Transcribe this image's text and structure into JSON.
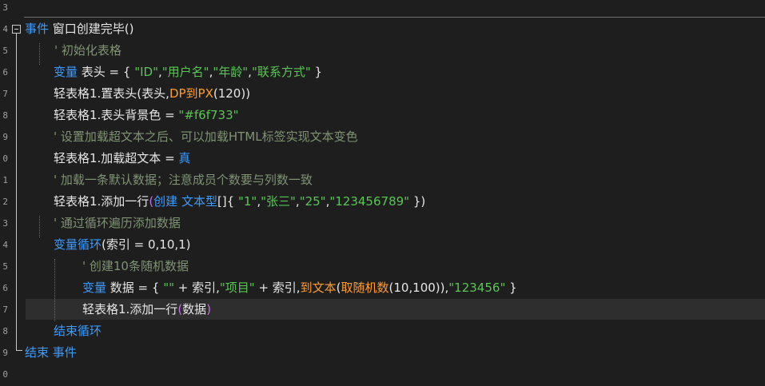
{
  "editor": {
    "line_numbers": [
      "3",
      "4",
      "5",
      "6",
      "7",
      "8",
      "9",
      "0",
      "1",
      "2",
      "3",
      "4",
      "5",
      "6",
      "7",
      "8",
      "9",
      "0"
    ],
    "lines": [
      {
        "tokens": [
          {
            "t": "事件",
            "c": "kw"
          },
          {
            "t": " 窗口创建完毕()",
            "c": "id"
          }
        ]
      },
      {
        "tokens": [
          {
            "t": "' 初始化表格",
            "c": "cm"
          }
        ]
      },
      {
        "tokens": [
          {
            "t": "变量",
            "c": "kw"
          },
          {
            "t": " 表头 = { ",
            "c": "id"
          },
          {
            "t": "\"ID\"",
            "c": "str"
          },
          {
            "t": ",",
            "c": "id"
          },
          {
            "t": "\"用户名\"",
            "c": "str"
          },
          {
            "t": ",",
            "c": "id"
          },
          {
            "t": "\"年龄\"",
            "c": "str"
          },
          {
            "t": ",",
            "c": "id"
          },
          {
            "t": "\"联系方式\"",
            "c": "str"
          },
          {
            "t": " }",
            "c": "id"
          }
        ]
      },
      {
        "tokens": [
          {
            "t": "轻表格1.置表头(表头,",
            "c": "id"
          },
          {
            "t": "DP到PX",
            "c": "fn"
          },
          {
            "t": "(120))",
            "c": "id"
          }
        ]
      },
      {
        "tokens": [
          {
            "t": "轻表格1.表头背景色 = ",
            "c": "id"
          },
          {
            "t": "\"#f6f733\"",
            "c": "str"
          }
        ]
      },
      {
        "tokens": [
          {
            "t": "' 设置加载超文本之后、可以加载HTML标签实现文本变色",
            "c": "cm"
          }
        ]
      },
      {
        "tokens": [
          {
            "t": "轻表格1.加载超文本 = ",
            "c": "id"
          },
          {
            "t": "真",
            "c": "kw"
          }
        ]
      },
      {
        "tokens": [
          {
            "t": "' 加载一条默认数据；注意成员个数要与列数一致",
            "c": "cm"
          }
        ]
      },
      {
        "tokens": [
          {
            "t": "轻表格1.添加一行",
            "c": "id"
          },
          {
            "t": "(",
            "c": "par-p"
          },
          {
            "t": "创建 文本型",
            "c": "kw"
          },
          {
            "t": "[]{ ",
            "c": "id"
          },
          {
            "t": "\"1\"",
            "c": "str"
          },
          {
            "t": ",",
            "c": "id"
          },
          {
            "t": "\"张三\"",
            "c": "str"
          },
          {
            "t": ",",
            "c": "id"
          },
          {
            "t": "\"25\"",
            "c": "str"
          },
          {
            "t": ",",
            "c": "id"
          },
          {
            "t": "\"123456789\"",
            "c": "str"
          },
          {
            "t": " })",
            "c": "id"
          }
        ]
      },
      {
        "tokens": [
          {
            "t": "' 通过循环遍历添加数据",
            "c": "cm"
          }
        ]
      },
      {
        "tokens": [
          {
            "t": "变量循环",
            "c": "kw"
          },
          {
            "t": "(索引 = 0,10,1)",
            "c": "id"
          }
        ]
      },
      {
        "tokens": [
          {
            "t": "' 创建10条随机数据",
            "c": "cm"
          }
        ]
      },
      {
        "tokens": [
          {
            "t": "变量",
            "c": "kw"
          },
          {
            "t": " 数据 = { ",
            "c": "id"
          },
          {
            "t": "\"\"",
            "c": "str"
          },
          {
            "t": " + 索引,",
            "c": "id"
          },
          {
            "t": "\"项目\"",
            "c": "str"
          },
          {
            "t": " + 索引,",
            "c": "id"
          },
          {
            "t": "到文本",
            "c": "fn"
          },
          {
            "t": "(",
            "c": "id"
          },
          {
            "t": "取随机数",
            "c": "fn"
          },
          {
            "t": "(10,100)),",
            "c": "id"
          },
          {
            "t": "\"123456\"",
            "c": "str"
          },
          {
            "t": " }",
            "c": "id"
          }
        ]
      },
      {
        "tokens": [
          {
            "t": "轻表格1.添加一行",
            "c": "id"
          },
          {
            "t": "(",
            "c": "par-p"
          },
          {
            "t": "数据",
            "c": "id"
          },
          {
            "t": ")",
            "c": "par-p"
          }
        ]
      },
      {
        "tokens": [
          {
            "t": "结束循环",
            "c": "kw"
          }
        ]
      },
      {
        "tokens": [
          {
            "t": "结束 事件",
            "c": "kw"
          }
        ]
      }
    ]
  }
}
